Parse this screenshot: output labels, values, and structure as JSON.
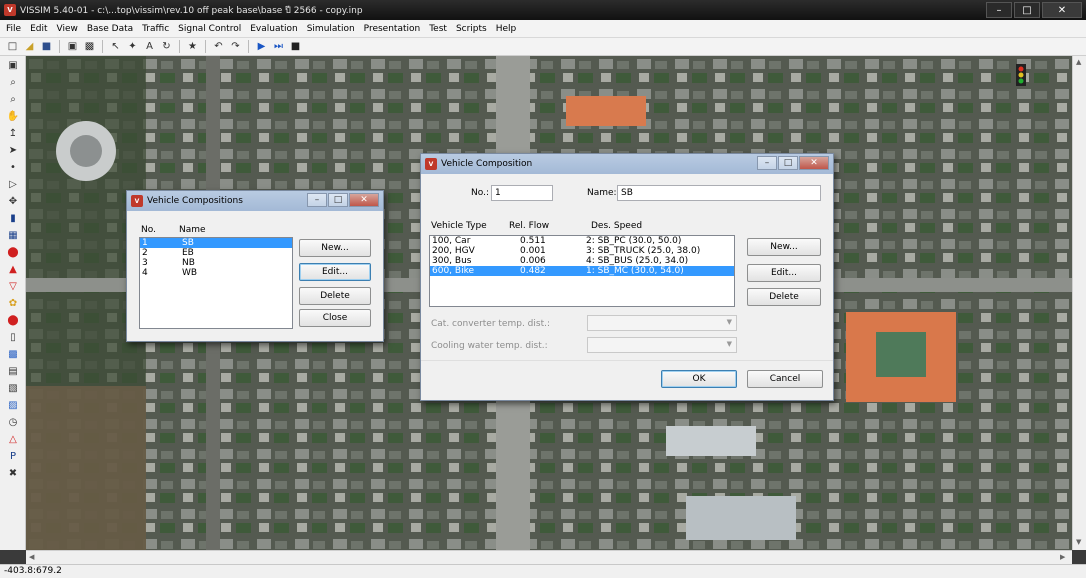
{
  "window": {
    "title": "VISSIM 5.40-01 - c:\\...top\\vissim\\rev.10  off peak base\\base ปี 2566 - copy.inp",
    "app_icon": "V",
    "minimize": "–",
    "maximize": "□",
    "close": "✕"
  },
  "menu": [
    "File",
    "Edit",
    "View",
    "Base Data",
    "Traffic",
    "Signal Control",
    "Evaluation",
    "Simulation",
    "Presentation",
    "Test",
    "Scripts",
    "Help"
  ],
  "toolbar_icons": [
    "new-file-icon",
    "open-folder-icon",
    "save-icon",
    "print-preview-icon",
    "print-icon",
    "select-arrow-icon",
    "network-icon",
    "text-size-icon",
    "rotate-icon",
    "pedestrian-icon",
    "undo-icon",
    "redo-icon",
    "play-icon",
    "step-forward-icon",
    "stop-icon"
  ],
  "left_tools": [
    "zoom-icon",
    "zoom-in-icon",
    "zoom-out-icon",
    "pan-icon",
    "link-icon",
    "route-icon",
    "node-icon",
    "select-icon",
    "move-icon",
    "vehicle-input-icon",
    "parking-icon",
    "stop-sign-icon",
    "warning-icon",
    "yield-icon",
    "priority-icon",
    "signal-icon",
    "traffic-light-icon",
    "detector-icon",
    "data-collection-icon",
    "travel-time-icon",
    "queue-counter-icon",
    "clock-icon",
    "alert-icon",
    "parking-lot-icon",
    "transit-icon"
  ],
  "status": {
    "coords": "-403.8:679.2"
  },
  "compositions_dialog": {
    "title": "Vehicle Compositions",
    "col_no": "No.",
    "col_name": "Name",
    "rows": [
      {
        "no": "1",
        "name": "SB",
        "selected": true
      },
      {
        "no": "2",
        "name": "EB",
        "selected": false
      },
      {
        "no": "3",
        "name": "NB",
        "selected": false
      },
      {
        "no": "4",
        "name": "WB",
        "selected": false
      }
    ],
    "buttons": {
      "new": "New...",
      "edit": "Edit...",
      "delete": "Delete",
      "close": "Close"
    }
  },
  "composition_dialog": {
    "title": "Vehicle Composition",
    "no_label": "No.:",
    "no_value": "1",
    "name_label": "Name:",
    "name_value": "SB",
    "col_type": "Vehicle Type",
    "col_flow": "Rel. Flow",
    "col_speed": "Des. Speed",
    "rows": [
      {
        "type": "100, Car",
        "flow": "0.511",
        "speed": "2: SB_PC (30.0, 50.0)",
        "selected": false
      },
      {
        "type": "200, HGV",
        "flow": "0.001",
        "speed": "3: SB_TRUCK (25.0, 38.0)",
        "selected": false
      },
      {
        "type": "300, Bus",
        "flow": "0.006",
        "speed": "4: SB_BUS (25.0, 34.0)",
        "selected": false
      },
      {
        "type": "600, Bike",
        "flow": "0.482",
        "speed": "1: SB_MC (30.0, 54.0)",
        "selected": true
      }
    ],
    "buttons": {
      "new": "New...",
      "edit": "Edit...",
      "delete": "Delete",
      "ok": "OK",
      "cancel": "Cancel"
    },
    "cat_label": "Cat. converter temp. dist.:",
    "cooling_label": "Cooling water temp. dist.:"
  }
}
